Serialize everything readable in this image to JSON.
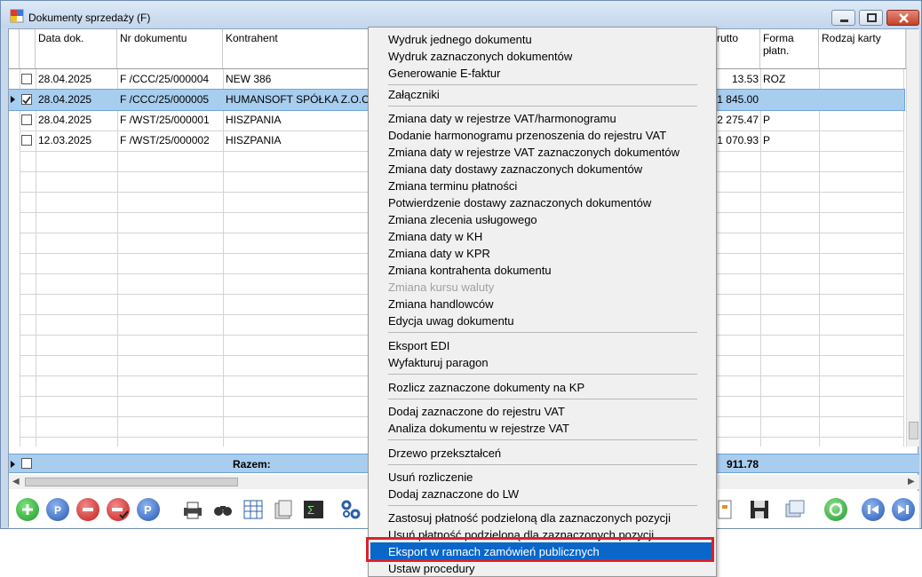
{
  "window": {
    "title": "Dokumenty sprzedaży (F)"
  },
  "grid": {
    "columns": {
      "date": "Data dok.",
      "number": "Nr dokumentu",
      "contractor": "Kontrahent",
      "gross": "rutto",
      "payment_form": "Forma\npłatn.",
      "card_type": "Rodzaj karty"
    },
    "rows": [
      {
        "checked": false,
        "date": "28.04.2025",
        "number": "F /CCC/25/000004",
        "contractor": "NEW 386",
        "gross": "13.53",
        "payment_form": "ROZ",
        "selected": false
      },
      {
        "checked": true,
        "date": "28.04.2025",
        "number": "F /CCC/25/000005",
        "contractor": "HUMANSOFT SPÓŁKA Z.O.O",
        "gross": "1 845.00",
        "payment_form": "",
        "selected": true
      },
      {
        "checked": false,
        "date": "28.04.2025",
        "number": "F /WST/25/000001",
        "contractor": "HISZPANIA",
        "gross": "2 275.47",
        "payment_form": "P",
        "selected": false
      },
      {
        "checked": false,
        "date": "12.03.2025",
        "number": "F /WST/25/000002",
        "contractor": "HISZPANIA",
        "gross": "1 070.93",
        "payment_form": "P",
        "selected": false
      }
    ],
    "totals": {
      "label": "Razem:",
      "gross": "911.78"
    }
  },
  "context_menu": {
    "groups": [
      [
        {
          "label": "Wydruk jednego dokumentu",
          "disabled": false
        },
        {
          "label": "Wydruk zaznaczonych dokumentów",
          "disabled": false
        },
        {
          "label": "Generowanie E-faktur",
          "disabled": false
        }
      ],
      [
        {
          "label": "Załączniki",
          "disabled": false
        }
      ],
      [
        {
          "label": "Zmiana daty w rejestrze VAT/harmonogramu",
          "disabled": false
        },
        {
          "label": "Dodanie harmonogramu przenoszenia do rejestru VAT",
          "disabled": false
        },
        {
          "label": "Zmiana daty w rejestrze VAT zaznaczonych dokumentów",
          "disabled": false
        },
        {
          "label": "Zmiana daty dostawy zaznaczonych dokumentów",
          "disabled": false
        },
        {
          "label": "Zmiana terminu płatności",
          "disabled": false
        },
        {
          "label": "Potwierdzenie dostawy zaznaczonych dokumentów",
          "disabled": false
        },
        {
          "label": "Zmiana zlecenia usługowego",
          "disabled": false
        },
        {
          "label": "Zmiana daty w KH",
          "disabled": false
        },
        {
          "label": "Zmiana daty w KPR",
          "disabled": false
        },
        {
          "label": "Zmiana kontrahenta dokumentu",
          "disabled": false
        },
        {
          "label": "Zmiana kursu waluty",
          "disabled": true
        },
        {
          "label": "Zmiana handlowców",
          "disabled": false
        },
        {
          "label": "Edycja uwag dokumentu",
          "disabled": false
        }
      ],
      [
        {
          "label": "Eksport EDI",
          "disabled": false
        },
        {
          "label": "Wyfakturuj paragon",
          "disabled": false
        }
      ],
      [
        {
          "label": "Rozlicz zaznaczone dokumenty na KP",
          "disabled": false
        }
      ],
      [
        {
          "label": "Dodaj zaznaczone do rejestru VAT",
          "disabled": false
        },
        {
          "label": "Analiza dokumentu w rejestrze VAT",
          "disabled": false
        }
      ],
      [
        {
          "label": "Drzewo przekształceń",
          "disabled": false
        }
      ],
      [
        {
          "label": "Usuń rozliczenie",
          "disabled": false
        },
        {
          "label": "Dodaj zaznaczone do LW",
          "disabled": false
        }
      ],
      [
        {
          "label": "Zastosuj płatność podzieloną dla zaznaczonych pozycji",
          "disabled": false
        },
        {
          "label": "Usuń płatność podzieloną dla zaznaczonych pozycji",
          "disabled": false
        },
        {
          "label": "Eksport w ramach zamówień publicznych",
          "disabled": false,
          "active": true
        },
        {
          "label": "Ustaw procedury",
          "disabled": false
        }
      ]
    ]
  },
  "toolbar": {
    "icons": [
      "add-icon",
      "preview-icon",
      "delete-icon",
      "cancel-approved-icon",
      "post-icon",
      "print-icon",
      "search-icon",
      "table-icon",
      "archive-icon",
      "sum-icon",
      "settings-icon",
      "export-icon",
      "save-icon",
      "copy-icon",
      "refresh-icon",
      "first-icon",
      "last-icon"
    ]
  },
  "colors": {
    "selection": "#a7cdef",
    "menu_highlight": "#0a67c9",
    "annotation": "#e0202a"
  }
}
